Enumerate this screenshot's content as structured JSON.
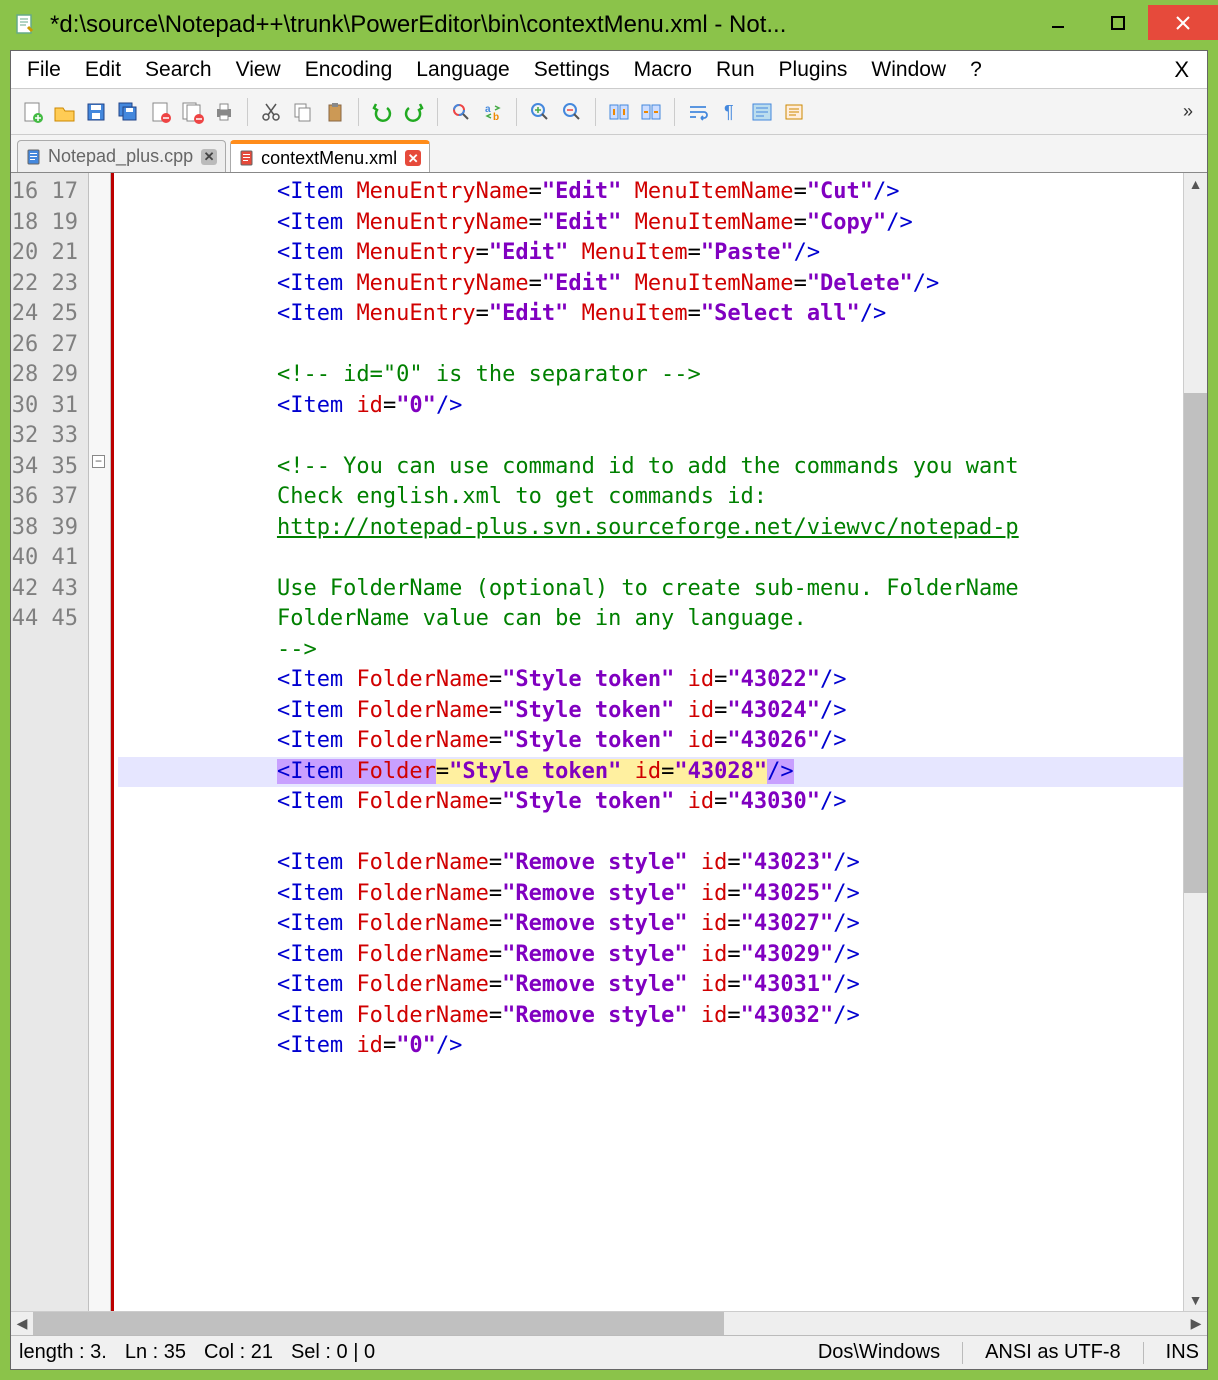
{
  "window": {
    "title": "*d:\\source\\Notepad++\\trunk\\PowerEditor\\bin\\contextMenu.xml - Not..."
  },
  "menubar": {
    "items": [
      "File",
      "Edit",
      "Search",
      "View",
      "Encoding",
      "Language",
      "Settings",
      "Macro",
      "Run",
      "Plugins",
      "Window",
      "?"
    ],
    "close": "X"
  },
  "tabs": [
    {
      "label": "Notepad_plus.cpp",
      "active": false
    },
    {
      "label": "contextMenu.xml",
      "active": true
    }
  ],
  "gutter": {
    "start": 16,
    "end": 45
  },
  "code": {
    "lines": [
      {
        "n": 16,
        "type": "item",
        "tag": "Item",
        "attrs": [
          [
            "MenuEntryName",
            "Edit"
          ],
          [
            "MenuItemName",
            "Cut"
          ]
        ]
      },
      {
        "n": 17,
        "type": "item",
        "tag": "Item",
        "attrs": [
          [
            "MenuEntryName",
            "Edit"
          ],
          [
            "MenuItemName",
            "Copy"
          ]
        ]
      },
      {
        "n": 18,
        "type": "item",
        "tag": "Item",
        "attrs": [
          [
            "MenuEntry",
            "Edit"
          ],
          [
            "MenuItem",
            "Paste"
          ]
        ],
        "cursor": true
      },
      {
        "n": 19,
        "type": "item",
        "tag": "Item",
        "attrs": [
          [
            "MenuEntryName",
            "Edit"
          ],
          [
            "MenuItemName",
            "Delete"
          ]
        ]
      },
      {
        "n": 20,
        "type": "item",
        "tag": "Item",
        "attrs": [
          [
            "MenuEntry",
            "Edit"
          ],
          [
            "MenuItem",
            "Select all"
          ]
        ]
      },
      {
        "n": 21,
        "type": "blank"
      },
      {
        "n": 22,
        "type": "comment",
        "text": "<!-- id=\"0\" is the separator -->"
      },
      {
        "n": 23,
        "type": "item",
        "tag": "Item",
        "attrs": [
          [
            "id",
            "0"
          ]
        ]
      },
      {
        "n": 24,
        "type": "blank"
      },
      {
        "n": 25,
        "type": "comment",
        "text": "<!-- You can use command id to add the commands you want"
      },
      {
        "n": 26,
        "type": "comment",
        "text": "Check english.xml to get commands id:"
      },
      {
        "n": 27,
        "type": "link",
        "text": "http://notepad-plus.svn.sourceforge.net/viewvc/notepad-p"
      },
      {
        "n": 28,
        "type": "blank"
      },
      {
        "n": 29,
        "type": "comment",
        "text": "Use FolderName (optional) to create sub-menu. FolderName"
      },
      {
        "n": 30,
        "type": "comment",
        "text": "FolderName value can be in any language."
      },
      {
        "n": 31,
        "type": "comment",
        "text": "-->"
      },
      {
        "n": 32,
        "type": "item",
        "tag": "Item",
        "attrs": [
          [
            "FolderName",
            "Style token"
          ],
          [
            "id",
            "43022"
          ]
        ]
      },
      {
        "n": 33,
        "type": "item",
        "tag": "Item",
        "attrs": [
          [
            "FolderName",
            "Style token"
          ],
          [
            "id",
            "43024"
          ]
        ]
      },
      {
        "n": 34,
        "type": "item",
        "tag": "Item",
        "attrs": [
          [
            "FolderName",
            "Style token"
          ],
          [
            "id",
            "43026"
          ]
        ]
      },
      {
        "n": 35,
        "type": "item-hl",
        "tag": "Item",
        "attrs": [
          [
            "Folder",
            "Style token"
          ],
          [
            "id",
            "43028"
          ]
        ]
      },
      {
        "n": 36,
        "type": "item",
        "tag": "Item",
        "attrs": [
          [
            "FolderName",
            "Style token"
          ],
          [
            "id",
            "43030"
          ]
        ]
      },
      {
        "n": 37,
        "type": "blank"
      },
      {
        "n": 38,
        "type": "item",
        "tag": "Item",
        "attrs": [
          [
            "FolderName",
            "Remove style"
          ],
          [
            "id",
            "43023"
          ]
        ]
      },
      {
        "n": 39,
        "type": "item",
        "tag": "Item",
        "attrs": [
          [
            "FolderName",
            "Remove style"
          ],
          [
            "id",
            "43025"
          ]
        ]
      },
      {
        "n": 40,
        "type": "item",
        "tag": "Item",
        "attrs": [
          [
            "FolderName",
            "Remove style"
          ],
          [
            "id",
            "43027"
          ]
        ]
      },
      {
        "n": 41,
        "type": "item",
        "tag": "Item",
        "attrs": [
          [
            "FolderName",
            "Remove style"
          ],
          [
            "id",
            "43029"
          ]
        ]
      },
      {
        "n": 42,
        "type": "item",
        "tag": "Item",
        "attrs": [
          [
            "FolderName",
            "Remove style"
          ],
          [
            "id",
            "43031"
          ]
        ]
      },
      {
        "n": 43,
        "type": "item",
        "tag": "Item",
        "attrs": [
          [
            "FolderName",
            "Remove style"
          ],
          [
            "id",
            "43032"
          ]
        ]
      },
      {
        "n": 44,
        "type": "item",
        "tag": "Item",
        "attrs": [
          [
            "id",
            "0"
          ]
        ]
      },
      {
        "n": 45,
        "type": "blank"
      }
    ],
    "indent": "            "
  },
  "statusbar": {
    "length": "length : 3.",
    "ln": "Ln : 35",
    "col": "Col : 21",
    "sel": "Sel : 0 | 0",
    "eol": "Dos\\Windows",
    "enc": "ANSI as UTF-8",
    "mode": "INS"
  },
  "toolbar_icons": [
    "new",
    "open",
    "save",
    "saveall",
    "close",
    "closeall",
    "print",
    "cut",
    "copy",
    "paste",
    "undo",
    "redo",
    "find",
    "replace",
    "zoom-in",
    "zoom-out",
    "sync-v",
    "sync-h",
    "wordwrap",
    "shownl",
    "highlight",
    "indent"
  ]
}
